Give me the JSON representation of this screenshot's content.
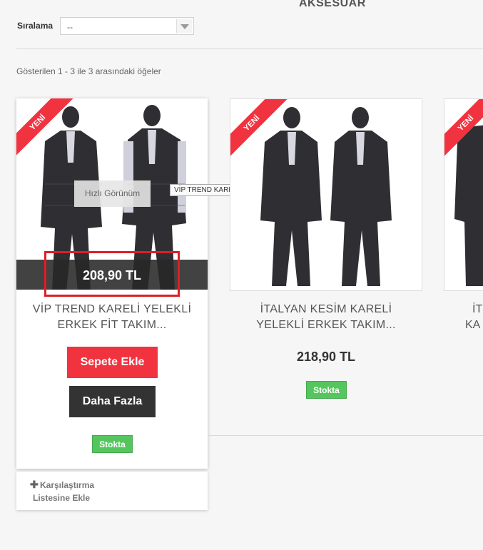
{
  "category_title": "AKSESUAR",
  "sort": {
    "label": "Sıralama",
    "value": "--"
  },
  "showing_text": "Gösterilen 1 - 3 ile 3 arasındaki öğeler",
  "products": [
    {
      "badge": "YENİ",
      "name_line1": "VİP TREND KARELİ YELEKLİ",
      "name_line2": "ERKEK FİT TAKIM...",
      "price": "208,90 TL",
      "quick_view": "Hızlı Görünüm",
      "tooltip": "VİP TREND KARELİ YELEKLİ ERKEK FİT TAKIM ELBİSE",
      "add_to_cart": "Sepete Ekle",
      "more": "Daha Fazla",
      "stock": "Stokta",
      "compare_line1": "Karşılaştırma",
      "compare_line2": "Listesine Ekle"
    },
    {
      "badge": "YENİ",
      "name_line1": "İTALYAN KESİM KARELİ",
      "name_line2": "YELEKLİ ERKEK TAKIM...",
      "price": "218,90 TL",
      "stock": "Stokta"
    },
    {
      "badge": "YENİ",
      "name_line1": "İT",
      "name_line2": "KA"
    }
  ],
  "colors": {
    "accent_red": "#f13340",
    "dark": "#333333",
    "stock_green": "#55c65e",
    "highlight": "#dd1f26"
  },
  "icons": {
    "select_arrow": "chevron-down-icon",
    "compare_plus": "plus-icon"
  }
}
